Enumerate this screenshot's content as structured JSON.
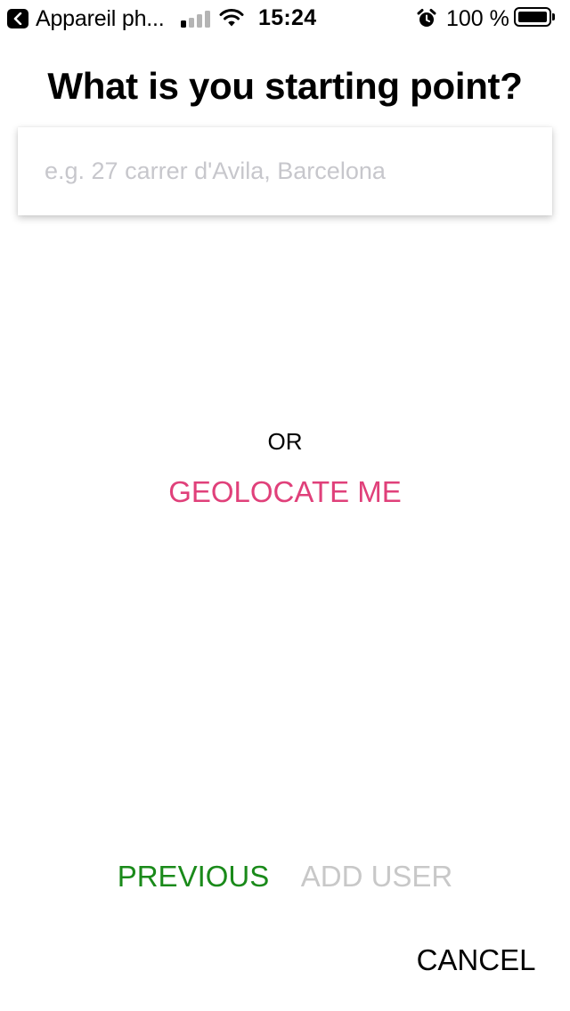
{
  "status_bar": {
    "back_app_label": "Appareil ph...",
    "time": "15:24",
    "battery_percent": "100 %",
    "battery_level": 1.0,
    "signal_bars_active": 1,
    "signal_bars_total": 4,
    "back_icon": "chevron-left-icon",
    "wifi_icon": "wifi-icon",
    "alarm_icon": "alarm-clock-icon"
  },
  "header": {
    "title": "What is you starting point?"
  },
  "address_input": {
    "value": "",
    "placeholder": "e.g. 27 carrer d'Avila, Barcelona"
  },
  "middle": {
    "or_label": "OR",
    "geolocate_label": "GEOLOCATE ME"
  },
  "footer": {
    "previous_label": "PREVIOUS",
    "add_user_label": "ADD USER",
    "cancel_label": "CANCEL"
  },
  "colors": {
    "geolocate": "#e0407a",
    "previous": "#1a8a1a",
    "add_user_disabled": "#c8c8c8",
    "cancel": "#000000",
    "signal_active": "#000000",
    "signal_inactive": "#b4b4b4"
  }
}
